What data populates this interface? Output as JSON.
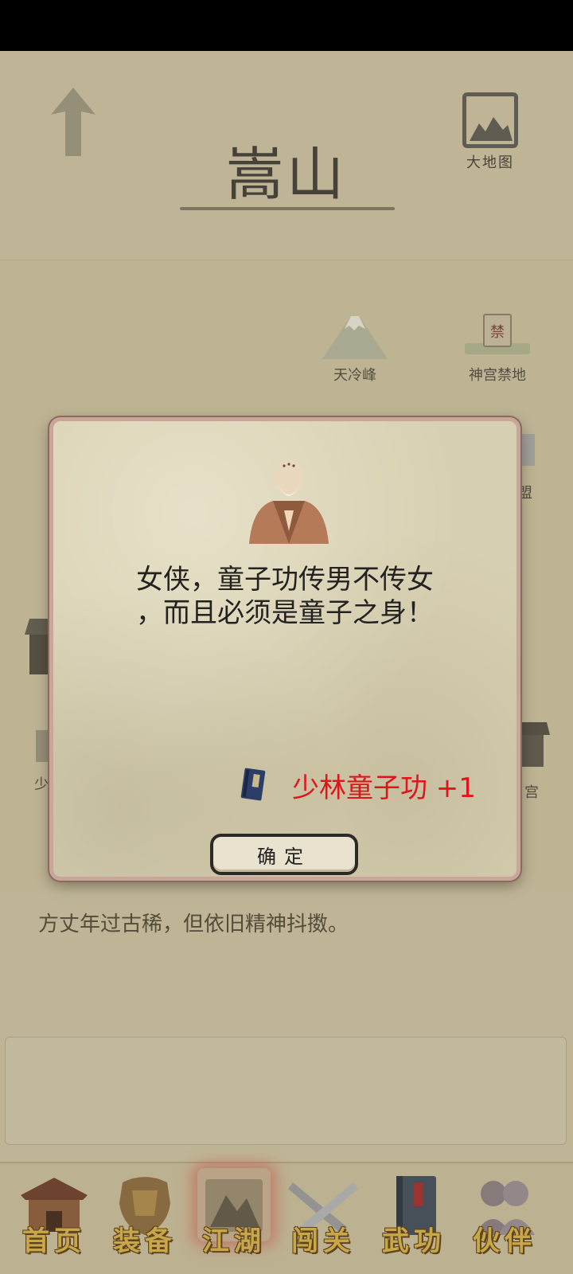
{
  "header": {
    "title": "嵩山",
    "map_button_label": "大地图"
  },
  "map": {
    "locations": [
      {
        "label": "天冷峰",
        "icon": "mountain-icon"
      },
      {
        "label": "神宫禁地",
        "icon": "stone-tablet-icon"
      },
      {
        "label": "盟",
        "icon": "scroll-icon"
      },
      {
        "label": "少",
        "icon": "temple-icon"
      },
      {
        "label": "宫",
        "icon": "palace-icon"
      }
    ]
  },
  "description": "方丈年过古稀，但依旧精神抖擞。",
  "dialog": {
    "message_line1": "女侠，童子功传男不传女",
    "message_line2": "，而且必须是童子之身！",
    "reward_text": "少林童子功 +1",
    "reward_icon": "book-icon",
    "confirm_label": "确定",
    "reward_color": "#e0141b"
  },
  "bottom_nav": {
    "items": [
      {
        "label": "首页",
        "icon": "house-icon"
      },
      {
        "label": "装备",
        "icon": "armor-icon"
      },
      {
        "label": "江湖",
        "icon": "map-scroll-icon",
        "active": true
      },
      {
        "label": "闯关",
        "icon": "swords-icon"
      },
      {
        "label": "武功",
        "icon": "manual-icon"
      },
      {
        "label": "伙伴",
        "icon": "companions-icon"
      }
    ]
  }
}
